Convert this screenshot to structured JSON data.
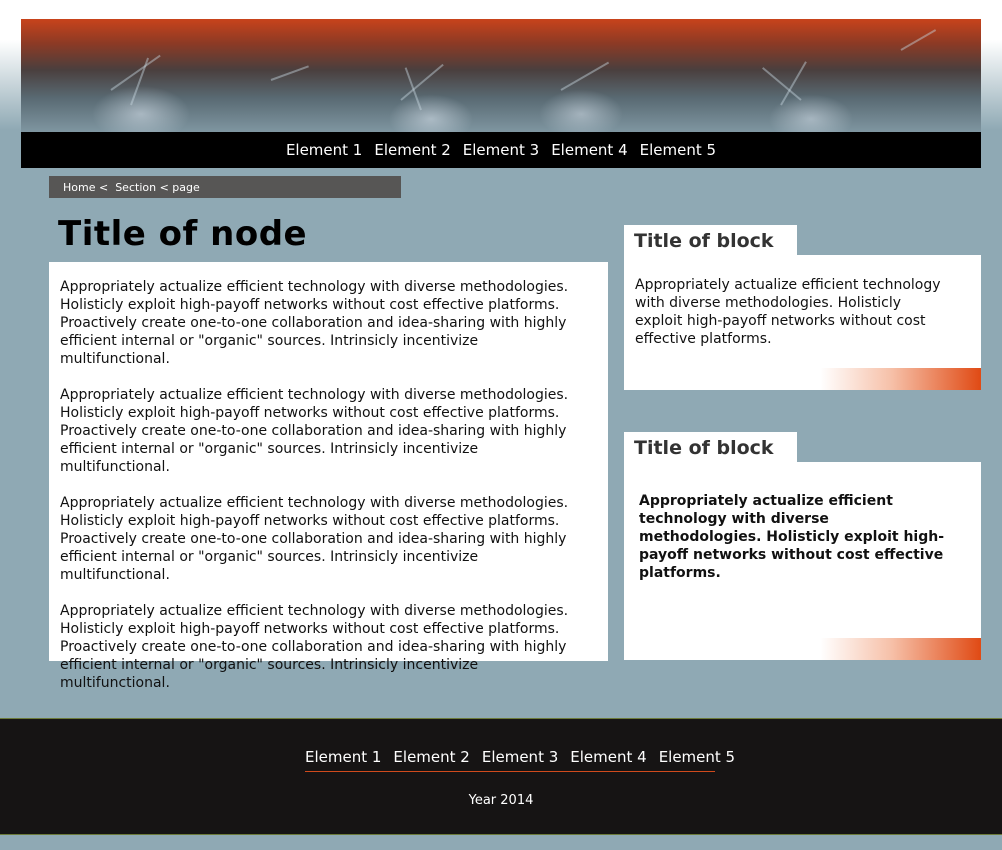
{
  "nav": {
    "items": [
      "Element 1",
      "Element 2",
      "Element 3",
      "Element 4",
      "Element 5"
    ]
  },
  "breadcrumb": {
    "home": "Home",
    "sep1": " <  ",
    "section": "Section",
    "sep2": " < ",
    "page": "page"
  },
  "node": {
    "title": "Title of node",
    "paragraphs": [
      "Appropriately actualize efficient technology with diverse methodologies. Ho­listicly exploit high-payoff networks without cost effective platforms. Proac­tively create one-to-one collaboration and idea-sharing with highly efficient internal or \"organic\" sources. Intrinsicly incentivize multifunctional.",
      "Appropriately actualize efficient technology with diverse methodologies. Ho­listicly exploit high-payoff networks without cost effective platforms. Proac­tively create one-to-one collaboration and idea-sharing with highly efficient internal or \"organic\" sources. Intrinsicly incentivize multifunctional.",
      "Appropriately actualize efficient technology with diverse methodologies. Ho­listicly exploit high-payoff networks without cost effective platforms. Proac­tively create one-to-one collaboration and idea-sharing with highly efficient internal or \"organic\" sources. Intrinsicly incentivize multifunctional.",
      "Appropriately actualize efficient technology with diverse methodologies. Ho­listicly exploit high-payoff networks without cost effective platforms. Proac­tively create one-to-one collaboration and idea-sharing with highly efficient internal or \"organic\" sources. Intrinsicly incentivize multifunctional."
    ]
  },
  "blocks": [
    {
      "title": "Title of block",
      "text": "Appropriately actualize efficient technology with diverse methodologies. Holisticly exploit high-payoff networks without cost effective platforms."
    },
    {
      "title": "Title of block",
      "text": "Appropriately actualize efficient technolo­gy with diverse methodologies. Holisticly exploit high-payoff networks without cost effective platforms."
    }
  ],
  "footer": {
    "nav_items": [
      "Element 1",
      "Element 2",
      "Element 3",
      "Element 4",
      "Element 5"
    ],
    "year": "Year 2014"
  },
  "colors": {
    "page_background": "#8fa9b4",
    "nav_background": "#000000",
    "footer_background": "#161414",
    "accent": "#e04a14"
  }
}
